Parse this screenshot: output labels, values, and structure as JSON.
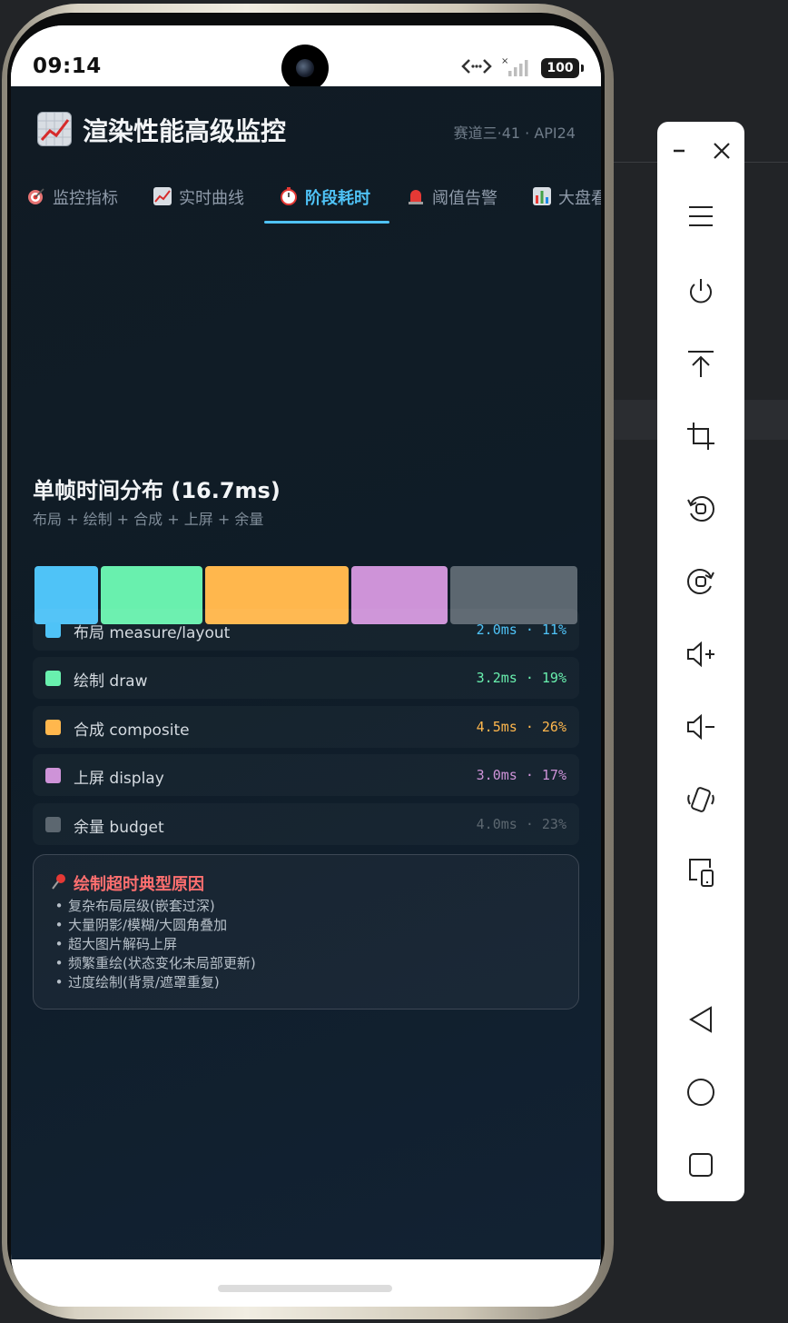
{
  "status": {
    "time": "09:14",
    "battery": "100"
  },
  "app": {
    "title": "渲染性能高级监控",
    "subtitle": "赛道三·41 · API24"
  },
  "tabs": [
    {
      "label": "监控指标",
      "icon": "target-icon",
      "active": false
    },
    {
      "label": "实时曲线",
      "icon": "chart-icon",
      "active": false
    },
    {
      "label": "阶段耗时",
      "icon": "stopwatch-icon",
      "active": true
    },
    {
      "label": "阈值告警",
      "icon": "siren-icon",
      "active": false
    },
    {
      "label": "大盘看板",
      "icon": "bar-chart-icon",
      "active": false
    }
  ],
  "section": {
    "title": "单帧时间分布 (16.7ms)",
    "subtitle": "布局 + 绘制 + 合成 + 上屏 + 余量"
  },
  "breakdown": [
    {
      "name": "布局 measure/layout",
      "value": "2.0ms · 11%",
      "ms": 2.0,
      "color": "#4fc3f7"
    },
    {
      "name": "绘制 draw",
      "value": "3.2ms · 19%",
      "ms": 3.2,
      "color": "#69f0ae"
    },
    {
      "name": "合成 composite",
      "value": "4.5ms · 26%",
      "ms": 4.5,
      "color": "#ffb74d"
    },
    {
      "name": "上屏 display",
      "value": "3.0ms · 17%",
      "ms": 3.0,
      "color": "#ce93d8"
    },
    {
      "name": "余量 budget",
      "value": "4.0ms · 23%",
      "ms": 4.0,
      "color": "#5c6770"
    }
  ],
  "causes": {
    "title": "绘制超时典型原因",
    "items": [
      "复杂布局层级(嵌套过深)",
      "大量阴影/模糊/大圆角叠加",
      "超大图片解码上屏",
      "频繁重绘(状态变化未局部更新)",
      "过度绘制(背景/遮罩重复)"
    ]
  },
  "toolbar": {
    "buttons": [
      "minimize-icon",
      "close-icon",
      "menu-icon",
      "power-icon",
      "pin-top-icon",
      "crop-icon",
      "rotate-left-icon",
      "rotate-right-icon",
      "volume-up-icon",
      "volume-down-icon",
      "shake-icon",
      "multi-device-icon",
      "back-icon",
      "home-icon",
      "overview-icon"
    ]
  },
  "colors": {
    "accent": "#4fc3f7",
    "warning": "#ff6f6f",
    "background": "#111b24"
  }
}
